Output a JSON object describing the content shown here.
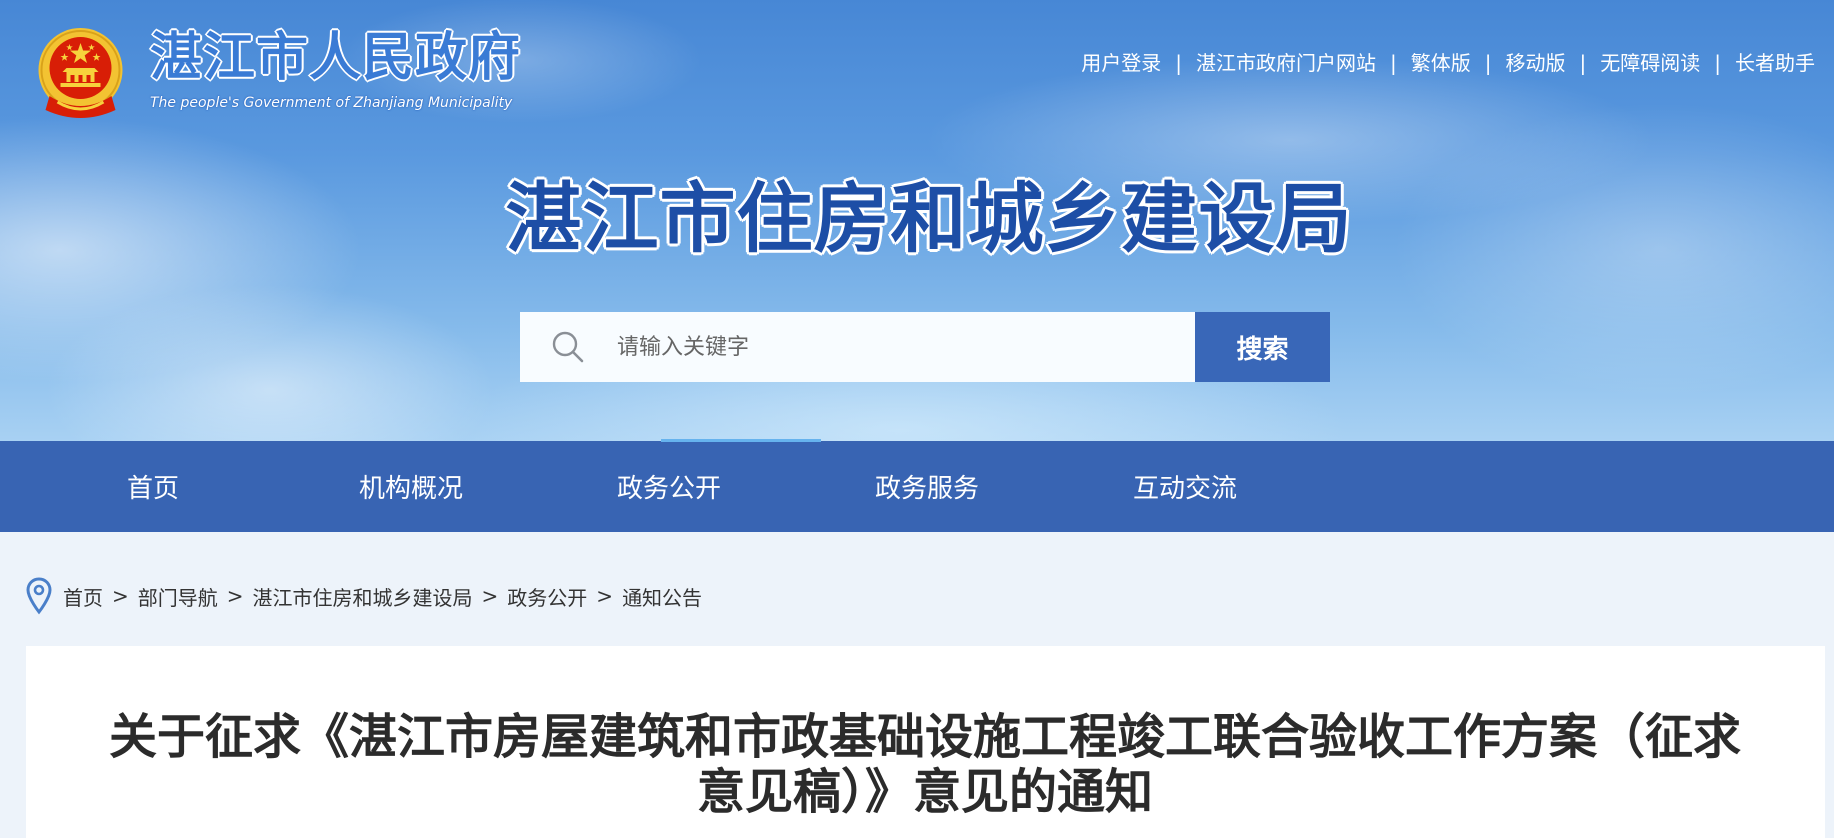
{
  "header": {
    "gov_name": "湛江市人民政府",
    "gov_name_en": "The people's Government of Zhanjiang Municipality",
    "top_links": [
      "用户登录",
      "湛江市政府门户网站",
      "繁体版",
      "移动版",
      "无障碍阅读",
      "长者助手"
    ],
    "link_separator": "|",
    "site_title": "湛江市住房和城乡建设局"
  },
  "search": {
    "placeholder": "请输入关键字",
    "button_label": "搜索"
  },
  "nav": {
    "items": [
      "首页",
      "机构概况",
      "政务公开",
      "政务服务",
      "互动交流"
    ]
  },
  "breadcrumb": {
    "items": [
      "首页",
      "部门导航",
      "湛江市住房和城乡建设局",
      "政务公开",
      "通知公告"
    ],
    "separator": ">"
  },
  "article": {
    "title": "关于征求《湛江市房屋建筑和市政基础设施工程竣工联合验收工作方案（征求意见稿）》意见的通知"
  },
  "icons": {
    "logo": "national-emblem-icon",
    "search": "search-icon",
    "breadcrumb": "location-pin-icon"
  },
  "colors": {
    "nav_bg": "#3864b3",
    "search_button": "#3967b8",
    "site_title": "#1d4ea6",
    "page_bg": "#edf3fa"
  }
}
